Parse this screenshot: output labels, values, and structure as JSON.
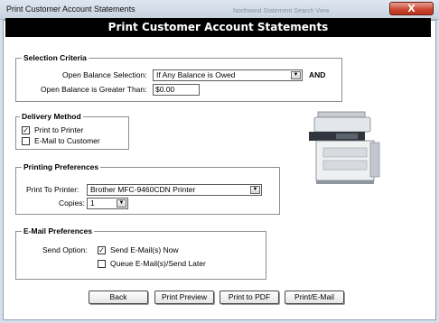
{
  "window": {
    "title": "Print Customer Account Statements",
    "background_text": "Northwind Statement Search View",
    "close_glyph": "X"
  },
  "header": {
    "title": "Print Customer Account Statements"
  },
  "selection": {
    "legend": "Selection Criteria",
    "open_balance_label": "Open Balance Selection:",
    "open_balance_value": "If Any Balance is Owed",
    "and_label": "AND",
    "greater_than_label": "Open Balance is Greater Than:",
    "greater_than_value": "$0.00"
  },
  "delivery": {
    "legend": "Delivery Method",
    "options": [
      {
        "label": "Print to Printer",
        "checked": true
      },
      {
        "label": "E-Mail to Customer",
        "checked": false
      }
    ]
  },
  "printing": {
    "legend": "Printing Preferences",
    "printer_label": "Print To Printer:",
    "printer_value": "Brother MFC-9460CDN Printer",
    "copies_label": "Copies:",
    "copies_value": "1"
  },
  "email": {
    "legend": "E-Mail  Preferences",
    "send_option_label": "Send Option:",
    "options": [
      {
        "label": "Send E-Mail(s) Now",
        "checked": true
      },
      {
        "label": "Queue E-Mail(s)/Send Later",
        "checked": false
      }
    ]
  },
  "buttons": {
    "back": "Back",
    "preview": "Print Preview",
    "pdf": "Print to PDF",
    "email": "Print/E-Mail"
  },
  "icons": {
    "dropdown": "chevron-down-icon",
    "checkbox": "checkbox-icon",
    "illustration": "printer-icon"
  }
}
